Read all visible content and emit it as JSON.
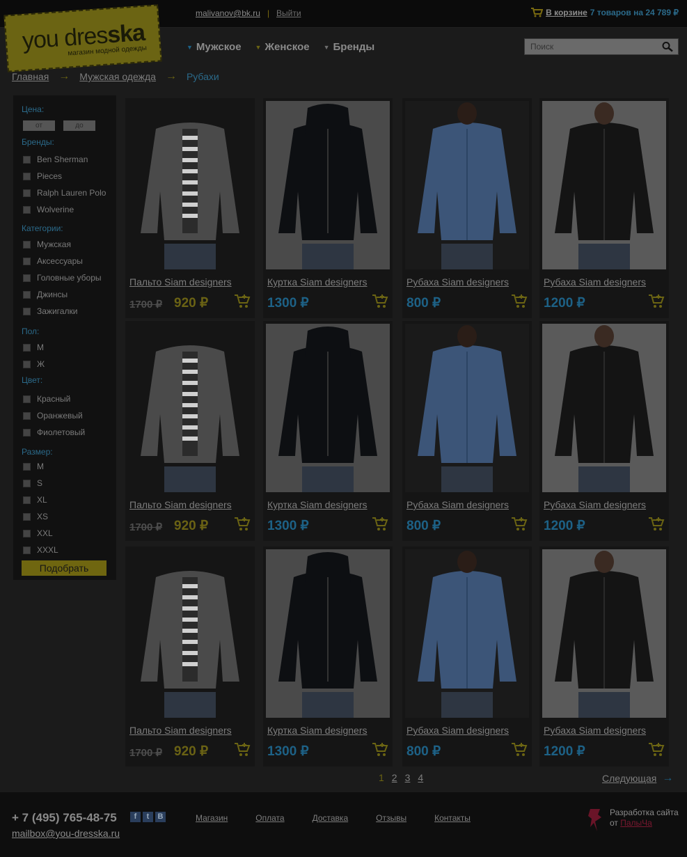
{
  "header": {
    "user_email": "malivanov@bk.ru",
    "separator": "|",
    "logout": "Выйти",
    "cart_link": "В корзине",
    "cart_info": "7 товаров на 24 789 ₽"
  },
  "logo": {
    "word_start": "you dres",
    "word_end": "ska",
    "subtitle": "магазин модной одежды"
  },
  "nav": {
    "items": [
      {
        "label": "Мужское",
        "arrow_color": "#1d6186"
      },
      {
        "label": "Женское",
        "arrow_color": "#6b6413"
      },
      {
        "label": "Бренды",
        "arrow_color": "#6e6e6e"
      }
    ]
  },
  "search": {
    "placeholder": "Поиск"
  },
  "breadcrumb": {
    "items": [
      "Главная",
      "Мужская одежда"
    ],
    "current": "Рубахи",
    "arrow": "→"
  },
  "filters": {
    "price_label": "Цена:",
    "price_from_placeholder": "от",
    "price_to_placeholder": "до",
    "brands_label": "Бренды:",
    "brands": [
      "Ben Sherman",
      "Pieces",
      "Ralph Lauren Polo",
      "Wolverine"
    ],
    "categories_label": "Категории:",
    "categories": [
      "Мужская",
      "Аксессуары",
      "Головные уборы",
      "Джинсы",
      "Зажигалки"
    ],
    "gender_label": "Пол:",
    "genders": [
      "М",
      "Ж"
    ],
    "color_label": "Цвет:",
    "colors": [
      "Красный",
      "Оранжевый",
      "Фиолетовый"
    ],
    "size_label": "Размер:",
    "sizes": [
      "M",
      "S",
      "XL",
      "XS",
      "XXL",
      "XXXL"
    ],
    "apply_button": "Подобрать"
  },
  "products": [
    {
      "title": "Пальто Siam designers",
      "old_price": "1700 ₽",
      "price": "920 ₽",
      "kind": "coat"
    },
    {
      "title": "Куртка Siam designers",
      "old_price": "",
      "price": "1300 ₽",
      "kind": "jacket"
    },
    {
      "title": "Рубаха Siam designers",
      "old_price": "",
      "price": "800 ₽",
      "kind": "blue-shirt"
    },
    {
      "title": "Рубаха Siam designers",
      "old_price": "",
      "price": "1200 ₽",
      "kind": "black-shirt"
    },
    {
      "title": "Пальто Siam designers",
      "old_price": "1700 ₽",
      "price": "920 ₽",
      "kind": "coat"
    },
    {
      "title": "Куртка Siam designers",
      "old_price": "",
      "price": "1300 ₽",
      "kind": "jacket"
    },
    {
      "title": "Рубаха Siam designers",
      "old_price": "",
      "price": "800 ₽",
      "kind": "blue-shirt"
    },
    {
      "title": "Рубаха Siam designers",
      "old_price": "",
      "price": "1200 ₽",
      "kind": "black-shirt"
    },
    {
      "title": "Пальто Siam designers",
      "old_price": "1700 ₽",
      "price": "920 ₽",
      "kind": "coat"
    },
    {
      "title": "Куртка Siam designers",
      "old_price": "",
      "price": "1300 ₽",
      "kind": "jacket"
    },
    {
      "title": "Рубаха Siam designers",
      "old_price": "",
      "price": "800 ₽",
      "kind": "blue-shirt"
    },
    {
      "title": "Рубаха Siam designers",
      "old_price": "",
      "price": "1200 ₽",
      "kind": "black-shirt"
    }
  ],
  "pagination": {
    "pages": [
      "1",
      "2",
      "3",
      "4"
    ],
    "active": "1",
    "next": "Следующая",
    "next_arrow": "→"
  },
  "footer": {
    "phone": "+ 7 (495) 765-48-75",
    "social": [
      "f",
      "t",
      "B"
    ],
    "email": "mailbox@you-dresska.ru",
    "nav": [
      "Магазин",
      "Оплата",
      "Доставка",
      "Отзывы",
      "Контакты"
    ],
    "dev_text": "Разработка сайта",
    "dev_from": "от",
    "dev_link": "ПалыЧа"
  },
  "colors": {
    "accent_yellow": "#6b6413",
    "accent_blue": "#1d6186",
    "background": "#1b1b1b"
  }
}
